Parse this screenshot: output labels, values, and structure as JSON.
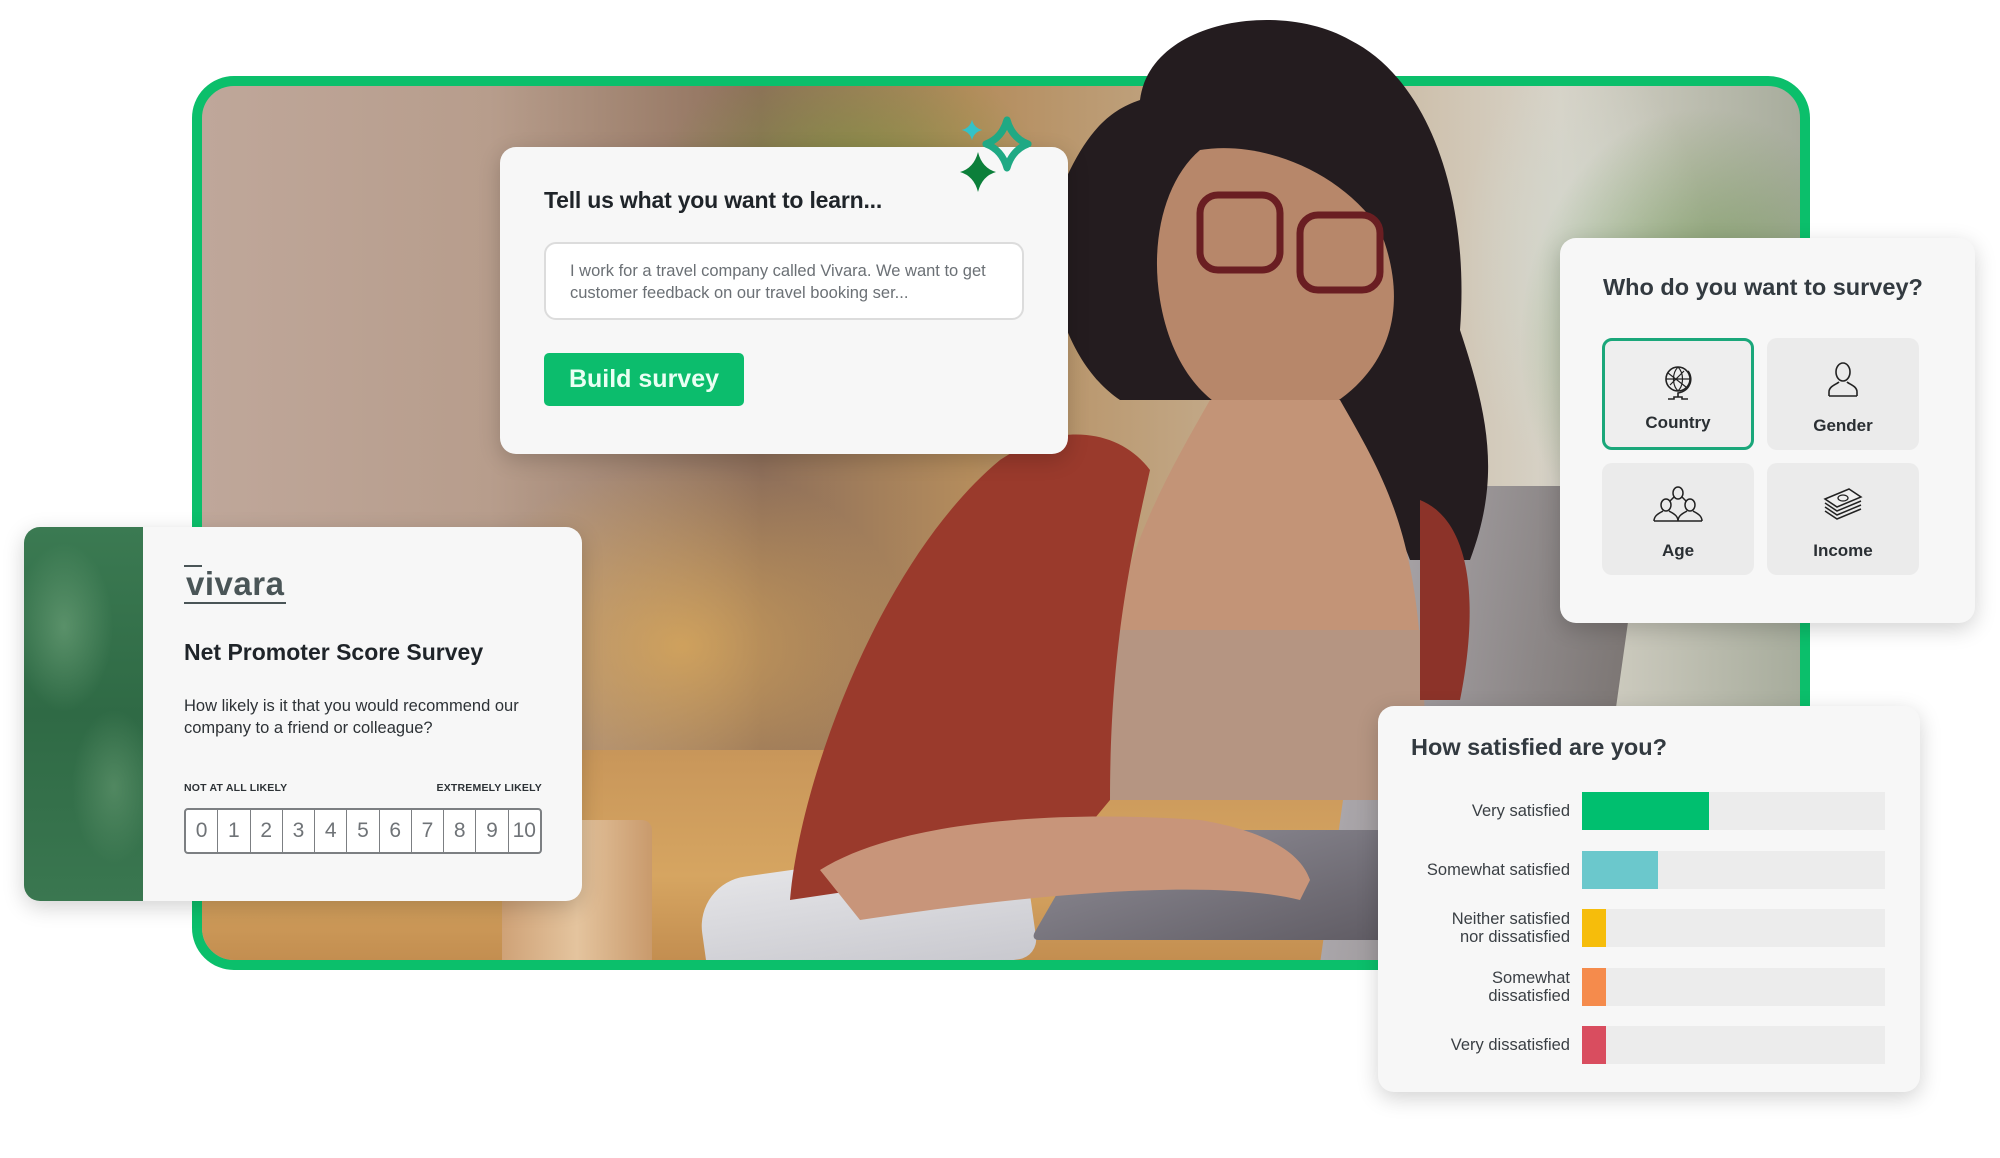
{
  "learn_card": {
    "title": "Tell us what you want to learn...",
    "prompt_value": "I work for a travel company called Vivara. We want to get customer feedback on our travel booking ser...",
    "build_button": "Build survey",
    "sparkle_icon": "sparkles-icon"
  },
  "target_card": {
    "title": "Who do you want to survey?",
    "options": [
      {
        "label": "Country",
        "icon": "globe-icon",
        "selected": true
      },
      {
        "label": "Gender",
        "icon": "person-icon",
        "selected": false
      },
      {
        "label": "Age",
        "icon": "group-icon",
        "selected": false
      },
      {
        "label": "Income",
        "icon": "money-icon",
        "selected": false
      }
    ]
  },
  "nps_card": {
    "brand": "vivara",
    "title": "Net Promoter Score Survey",
    "question": "How likely is it that you would recommend our company to a friend or colleague?",
    "scale_low_label": "NOT AT ALL LIKELY",
    "scale_high_label": "EXTREMELY LIKELY",
    "scale": [
      "0",
      "1",
      "2",
      "3",
      "4",
      "5",
      "6",
      "7",
      "8",
      "9",
      "10"
    ]
  },
  "satisfaction_card": {
    "title": "How satisfied are you?",
    "rows": [
      {
        "label": "Very satisfied",
        "percent": 42,
        "color": "#00bf6f"
      },
      {
        "label": "Somewhat satisfied",
        "percent": 25,
        "color": "#6bc8cc"
      },
      {
        "label": "Neither satisfied\nnor dissatisfied",
        "percent": 8,
        "color": "#f6bd0b"
      },
      {
        "label": "Somewhat\ndissatisfied",
        "percent": 8,
        "color": "#f58b4c"
      },
      {
        "label": "Very dissatisfied",
        "percent": 8,
        "color": "#d94d5f"
      }
    ]
  },
  "colors": {
    "brand_green": "#0bbf6b",
    "selected_border": "#1aa77a"
  }
}
